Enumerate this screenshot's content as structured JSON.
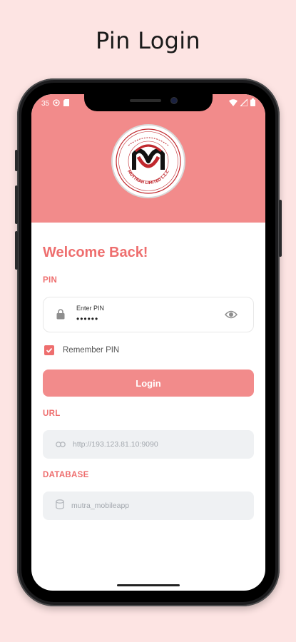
{
  "page_title": "Pin Login",
  "status_bar": {
    "time": "35"
  },
  "form": {
    "welcome": "Welcome Back!",
    "pin_label": "PIN",
    "pin_field_label": "Enter PIN",
    "pin_value": "••••••",
    "remember_label": "Remember PIN",
    "remember_checked": true,
    "login_button": "Login",
    "url_label": "URL",
    "url_value": "http://193.123.81.10:9090",
    "db_label": "DATABASE",
    "db_value": "mutra_mobileapp"
  },
  "logo": {
    "text": "MUTTRAH LIMITED L.L.C"
  },
  "colors": {
    "background": "#fde4e3",
    "header": "#f28b8b",
    "accent": "#ee6e6e",
    "readonly_field": "#eff1f3"
  },
  "icons": {
    "pin": "lock-icon",
    "toggle": "eye-icon",
    "url": "link-icon",
    "db": "database-icon",
    "checkbox": "check-icon"
  }
}
